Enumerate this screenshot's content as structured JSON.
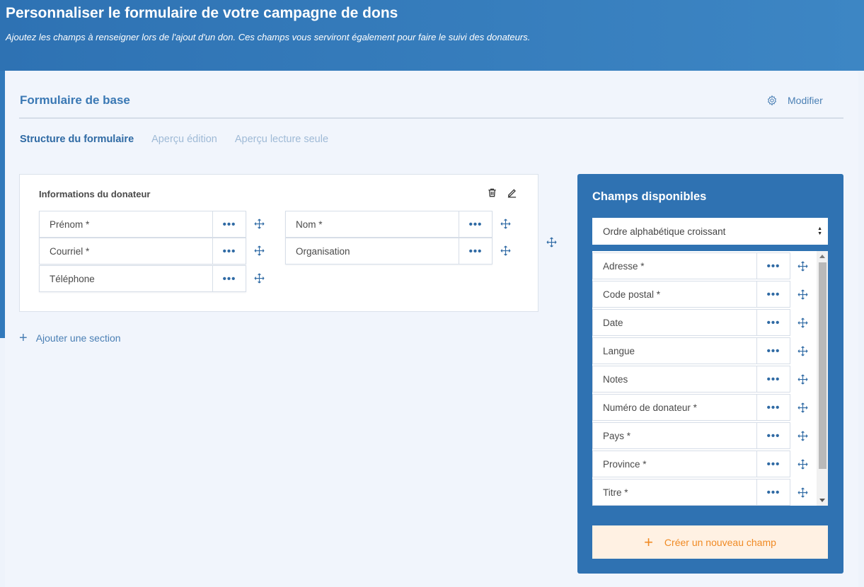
{
  "header": {
    "title": "Personnaliser le formulaire de votre campagne de dons",
    "subtitle": "Ajoutez les champs à renseigner lors de l'ajout d'un don. Ces champs vous serviront également pour faire le suivi des donateurs."
  },
  "form": {
    "title": "Formulaire de base",
    "modify_label": "Modifier",
    "tabs": [
      {
        "label": "Structure du formulaire",
        "active": true
      },
      {
        "label": "Aperçu édition",
        "active": false
      },
      {
        "label": "Aperçu lecture seule",
        "active": false
      }
    ]
  },
  "section": {
    "title": "Informations du donateur",
    "left_fields": [
      {
        "label": "Prénom *"
      },
      {
        "label": "Courriel *"
      },
      {
        "label": "Téléphone"
      }
    ],
    "right_fields": [
      {
        "label": "Nom *"
      },
      {
        "label": "Organisation"
      }
    ],
    "menu_glyph": "•••"
  },
  "add_section_label": "Ajouter une section",
  "available": {
    "title": "Champs disponibles",
    "sort_value": "Ordre alphabétique croissant",
    "fields": [
      {
        "label": "Adresse *"
      },
      {
        "label": "Code postal *"
      },
      {
        "label": "Date"
      },
      {
        "label": "Langue"
      },
      {
        "label": "Notes"
      },
      {
        "label": "Numéro de donateur *"
      },
      {
        "label": "Pays *"
      },
      {
        "label": "Province *"
      },
      {
        "label": "Titre *"
      }
    ],
    "create_label": "Créer un nouveau champ"
  },
  "colors": {
    "primary": "#2f72b2",
    "accent_orange": "#f08a24",
    "background": "#eef3fb"
  }
}
